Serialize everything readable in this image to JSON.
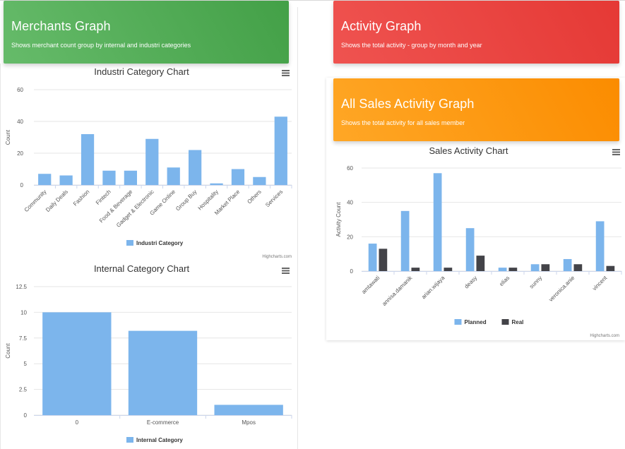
{
  "merchants_header": {
    "title": "Merchants Graph",
    "subtitle": "Shows merchant count group by internal and industri categories"
  },
  "activity_header": {
    "title": "Activity Graph",
    "subtitle": "Shows the total activity - group by month and year"
  },
  "sales_header": {
    "title": "All Sales Activity Graph",
    "subtitle": "Shows the total activity for all sales member"
  },
  "colors": {
    "planned": "#7cb5ec",
    "real": "#434348",
    "green": "#43a047",
    "red": "#e53935",
    "orange": "#fb8c00"
  },
  "credits": "Highcharts.com",
  "icons": {
    "menu": "hamburger-menu-icon"
  },
  "chart_data": [
    {
      "id": "industri",
      "type": "bar",
      "title": "Industri Category Chart",
      "ylabel": "Count",
      "xlabel": "",
      "ylim": [
        0,
        60
      ],
      "yticks": [
        0,
        20,
        40,
        60
      ],
      "categories": [
        "Community",
        "Daily Deals",
        "Fashion",
        "Fintech",
        "Food & Beverage",
        "Gadget & Electronic",
        "Game Online",
        "Group Buy",
        "Hospitality",
        "Market Place",
        "Others",
        "Services"
      ],
      "series": [
        {
          "name": "Industri Category",
          "values": [
            7,
            6,
            32,
            9,
            9,
            29,
            11,
            22,
            1,
            10,
            5,
            43
          ]
        }
      ],
      "legend": "bottom-center"
    },
    {
      "id": "internal",
      "type": "bar",
      "title": "Internal Category Chart",
      "ylabel": "Count",
      "xlabel": "",
      "ylim": [
        0,
        12.5
      ],
      "yticks": [
        0,
        2.5,
        5,
        7.5,
        10,
        12.5
      ],
      "categories": [
        "0",
        "E-commerce",
        "Mpos"
      ],
      "series": [
        {
          "name": "Internal Category",
          "values": [
            10,
            8.2,
            1
          ]
        }
      ],
      "legend": "bottom-center"
    },
    {
      "id": "sales",
      "type": "bar",
      "title": "Sales Activity Chart",
      "ylabel": "Activity Count",
      "xlabel": "",
      "ylim": [
        0,
        60
      ],
      "yticks": [
        0,
        20,
        40,
        60
      ],
      "categories": [
        "amtawati",
        "annisa.damanik",
        "arian.wijaya",
        "deasy",
        "elias",
        "sunny",
        "veronica.anie",
        "vincent"
      ],
      "series": [
        {
          "name": "Planned",
          "values": [
            16,
            35,
            57,
            25,
            2,
            4,
            7,
            29
          ]
        },
        {
          "name": "Real",
          "values": [
            13,
            2,
            2,
            9,
            2,
            4,
            4,
            3
          ]
        }
      ],
      "legend": "bottom-center"
    }
  ]
}
